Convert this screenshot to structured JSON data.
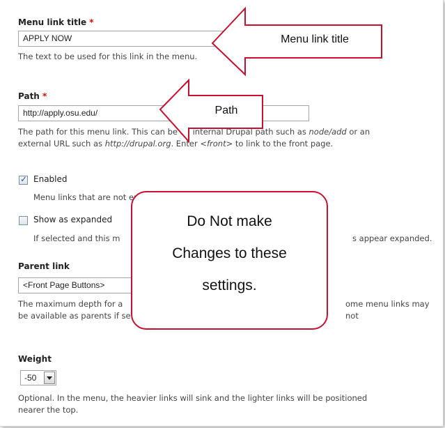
{
  "form": {
    "menu_link_title": {
      "label": "Menu link title",
      "required_mark": "*",
      "value": "APPLY NOW",
      "description": "The text to be used for this link in the menu."
    },
    "path": {
      "label": "Path",
      "required_mark": "*",
      "value": "http://apply.osu.edu/",
      "description_line1_a": "The path for this menu link. This ca",
      "description_line1_b": "n be an internal Drupal path such as ",
      "description_line1_em": "node/add",
      "description_line1_c": " or an",
      "description_line2_a": "external URL such as ",
      "description_line2_em": "http://drupal.org",
      "description_line2_b": ". Enter ",
      "description_line2_em2": "<front>",
      "description_line2_c": " to link to the front page."
    },
    "enabled": {
      "label": "Enabled",
      "checked": true,
      "description": "Menu links that are not enabled will not be listed in any menu."
    },
    "show_as_expanded": {
      "label": "Show as expanded",
      "checked": false,
      "description_a": "If selected and this m",
      "description_b": "s appear expanded."
    },
    "parent_link": {
      "label": "Parent link",
      "value": "<Front Page Buttons>",
      "description_line1_a": "The maximum depth for a",
      "description_line1_b": "ome menu links may not",
      "description_line2": "be available as parents if selecting them would exceed this limit."
    },
    "weight": {
      "label": "Weight",
      "value": "-50",
      "description_line1": "Optional. In the menu, the heavier links will sink and the lighter links will be positioned",
      "description_line2": "nearer the top."
    }
  },
  "annotations": {
    "arrow_title": "Menu link title",
    "arrow_path": "Path",
    "callout_line1": "Do Not make",
    "callout_line2": "Changes to these",
    "callout_line3": "settings."
  },
  "colors": {
    "annotation_border": "#c8102e",
    "required": "#e00000",
    "checkbox_check": "#2a4e9a"
  }
}
